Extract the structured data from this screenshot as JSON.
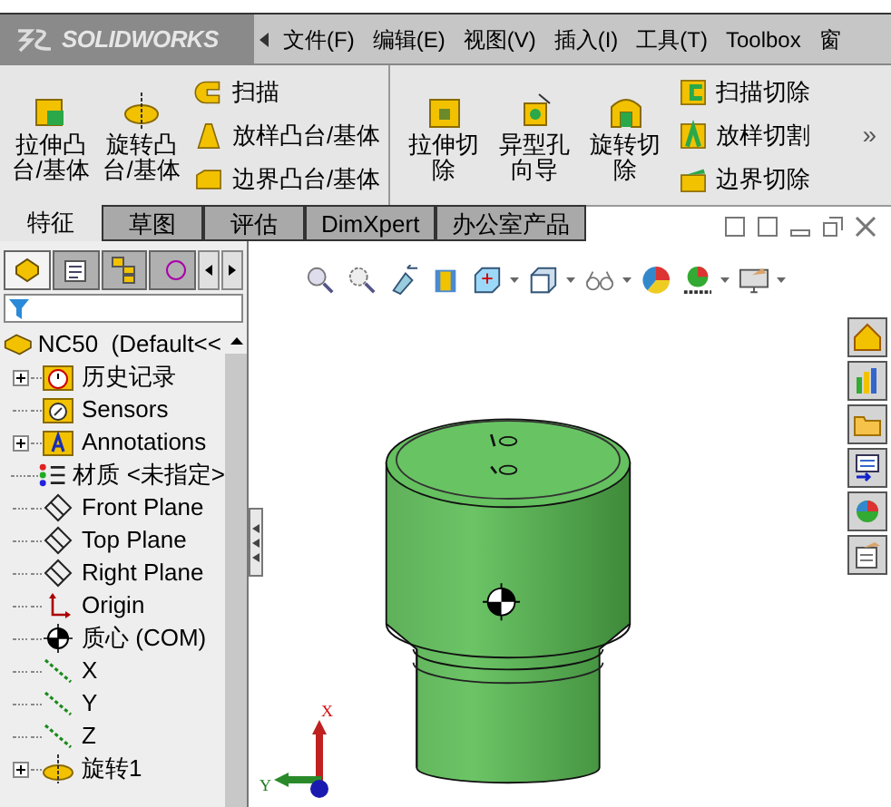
{
  "app_logo": {
    "text": "SOLIDWORKS"
  },
  "menu": [
    {
      "label": "文件(F)"
    },
    {
      "label": "编辑(E)"
    },
    {
      "label": "视图(V)"
    },
    {
      "label": "插入(I)"
    },
    {
      "label": "工具(T)"
    },
    {
      "label": "Toolbox"
    },
    {
      "label": "窗"
    }
  ],
  "ribbon": {
    "groups": [
      {
        "large": [
          {
            "label": "拉伸凸台/基体"
          },
          {
            "label": "旋转凸台/基体"
          }
        ],
        "small": [
          {
            "label": "扫描"
          },
          {
            "label": "放样凸台/基体"
          },
          {
            "label": "边界凸台/基体"
          }
        ]
      },
      {
        "large": [
          {
            "label": "拉伸切除"
          },
          {
            "label": "异型孔向导"
          },
          {
            "label": "旋转切除"
          }
        ],
        "small": [
          {
            "label": "扫描切除"
          },
          {
            "label": "放样切割"
          },
          {
            "label": "边界切除"
          }
        ]
      }
    ],
    "more": "»"
  },
  "tabs": [
    {
      "label": "特征",
      "selected": true
    },
    {
      "label": "草图",
      "selected": false
    },
    {
      "label": "评估",
      "selected": false
    },
    {
      "label": "DimXpert",
      "selected": false
    },
    {
      "label": "办公室产品",
      "selected": false
    }
  ],
  "feature_manager": {
    "panel_tabs": [
      {
        "selected": true
      },
      {
        "selected": false
      },
      {
        "selected": false
      },
      {
        "selected": false
      }
    ],
    "root": {
      "label": "NC50  (Default<<"
    },
    "tree": [
      {
        "kind": "history",
        "label": "历史记录",
        "expanded": false
      },
      {
        "kind": "sensors",
        "label": "Sensors"
      },
      {
        "kind": "annotations",
        "label": "Annotations",
        "expanded": false
      },
      {
        "kind": "material",
        "label": "材质 <未指定>"
      },
      {
        "kind": "plane",
        "label": "Front Plane"
      },
      {
        "kind": "plane",
        "label": "Top Plane"
      },
      {
        "kind": "plane",
        "label": "Right Plane"
      },
      {
        "kind": "origin",
        "label": "Origin"
      },
      {
        "kind": "com",
        "label": "质心 (COM)"
      },
      {
        "kind": "axis",
        "label": "X"
      },
      {
        "kind": "axis",
        "label": "Y"
      },
      {
        "kind": "axis",
        "label": "Z"
      },
      {
        "kind": "revolve",
        "label": "旋转1",
        "expanded": false
      }
    ]
  },
  "triad": {
    "x_label": "X",
    "y_label": "Y"
  }
}
